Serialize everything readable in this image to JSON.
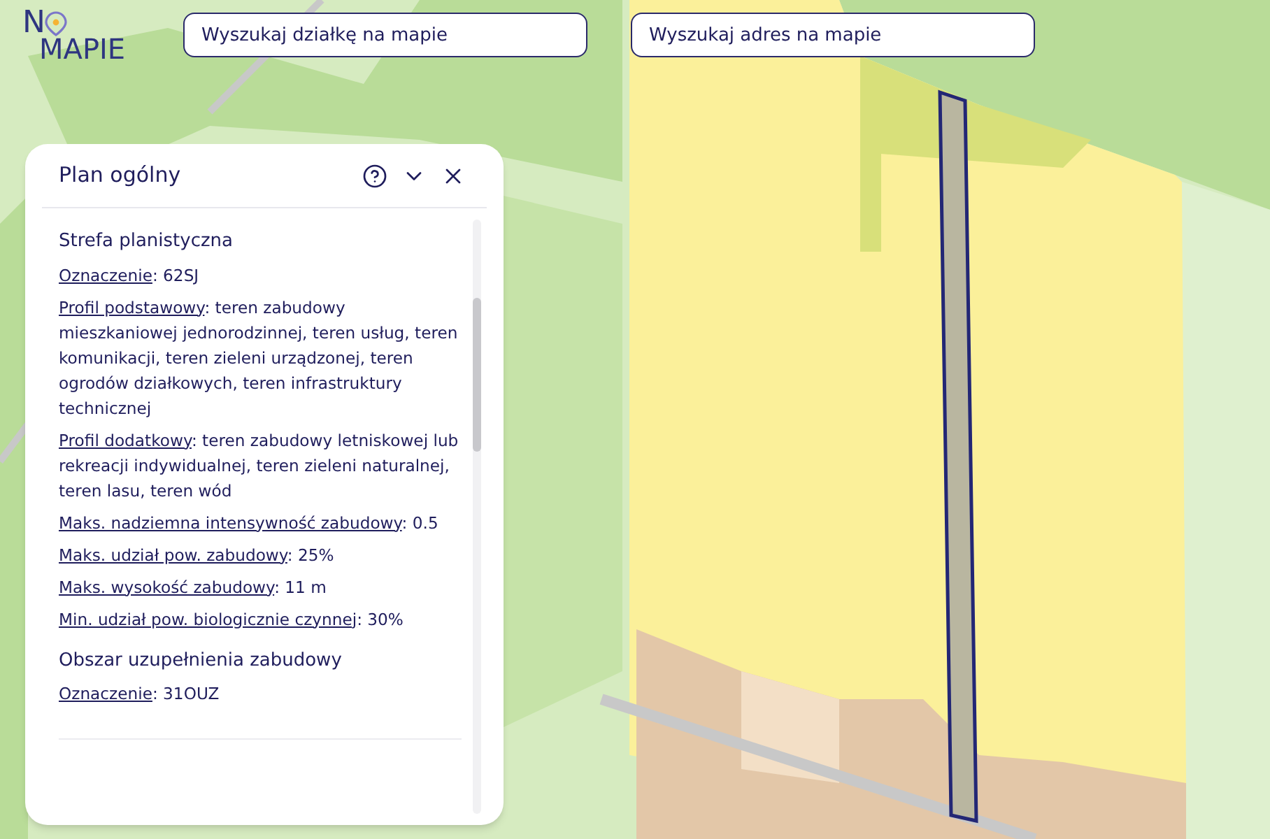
{
  "logo": {
    "line_1": "N",
    "line_2": "MAPIE"
  },
  "search_fields": [
    {
      "placeholder": "Wyszukaj działkę na mapie"
    },
    {
      "placeholder": "Wyszukaj adres na mapie"
    }
  ],
  "panel": {
    "title": "Plan ogólny",
    "sections": [
      {
        "heading": "Strefa planistyczna",
        "entries": [
          {
            "label": "Oznaczenie",
            "value": ": 62SJ"
          },
          {
            "label": "Profil podstawowy",
            "value": ": teren zabudowy mieszkaniowej jednorodzinnej, teren usług, teren komunikacji, teren zieleni urządzonej, teren ogrodów działkowych, teren infrastruktury technicznej"
          },
          {
            "label": "Profil dodatkowy",
            "value": ": teren zabudowy letniskowej lub rekreacji indywidualnej, teren zieleni naturalnej, teren lasu, teren wód"
          },
          {
            "label": "Maks. nadziemna intensywność zabudowy",
            "value": ": 0.5"
          },
          {
            "label": "Maks. udział pow. zabudowy",
            "value": ": 25%"
          },
          {
            "label": "Maks. wysokość zabudowy",
            "value": ": 11 m"
          },
          {
            "label": "Min. udział pow. biologicznie czynnej",
            "value": ": 30%"
          }
        ]
      },
      {
        "heading": "Obszar uzupełnienia zabudowy",
        "entries": [
          {
            "label": "Oznaczenie",
            "value": ": 31OUZ"
          }
        ]
      }
    ]
  }
}
